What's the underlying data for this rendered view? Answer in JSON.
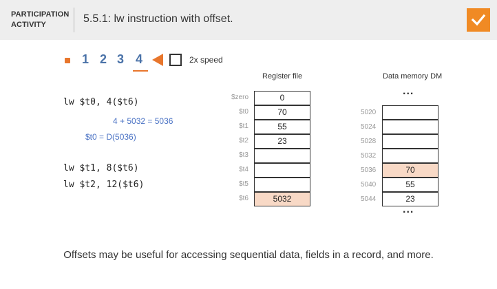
{
  "header": {
    "activity_kind_line1": "PARTICIPATION",
    "activity_kind_line2": "ACTIVITY",
    "title": "5.5.1: lw instruction with offset.",
    "completed_icon": "checkmark-icon",
    "accent_color": "#f08a24"
  },
  "controls": {
    "start_icon": "square-icon",
    "steps": [
      "1",
      "2",
      "3",
      "4"
    ],
    "current_step": "4",
    "play_icon": "triangle-play-icon",
    "speed_label": "2x speed",
    "speed_checked": false
  },
  "program": {
    "line1": "lw $t0, 4($t6)",
    "note_add": "4 + 5032 = 5036",
    "note_load": "$t0 = D(5036)",
    "line2": "lw $t1, 8($t6)",
    "line3": "lw $t2, 12($t6)"
  },
  "register_file": {
    "title": "Register file",
    "registers": [
      {
        "name": "$zero",
        "value": "0",
        "highlight": false
      },
      {
        "name": "$t0",
        "value": "70",
        "highlight": false
      },
      {
        "name": "$t1",
        "value": "55",
        "highlight": false
      },
      {
        "name": "$t2",
        "value": "23",
        "highlight": false
      },
      {
        "name": "$t3",
        "value": "",
        "highlight": false
      },
      {
        "name": "$t4",
        "value": "",
        "highlight": false
      },
      {
        "name": "$t5",
        "value": "",
        "highlight": false
      },
      {
        "name": "$t6",
        "value": "5032",
        "highlight": true
      }
    ]
  },
  "data_memory": {
    "title": "Data memory DM",
    "ellipsis_top": "...",
    "ellipsis_bottom": "...",
    "rows": [
      {
        "address": "5020",
        "value": "",
        "highlight": false
      },
      {
        "address": "5024",
        "value": "",
        "highlight": false
      },
      {
        "address": "5028",
        "value": "",
        "highlight": false
      },
      {
        "address": "5032",
        "value": "",
        "highlight": false
      },
      {
        "address": "5036",
        "value": "70",
        "highlight": true
      },
      {
        "address": "5040",
        "value": "55",
        "highlight": false
      },
      {
        "address": "5044",
        "value": "23",
        "highlight": false
      }
    ]
  },
  "caption": "Offsets may be useful for accessing sequential data, fields in a record, and more."
}
